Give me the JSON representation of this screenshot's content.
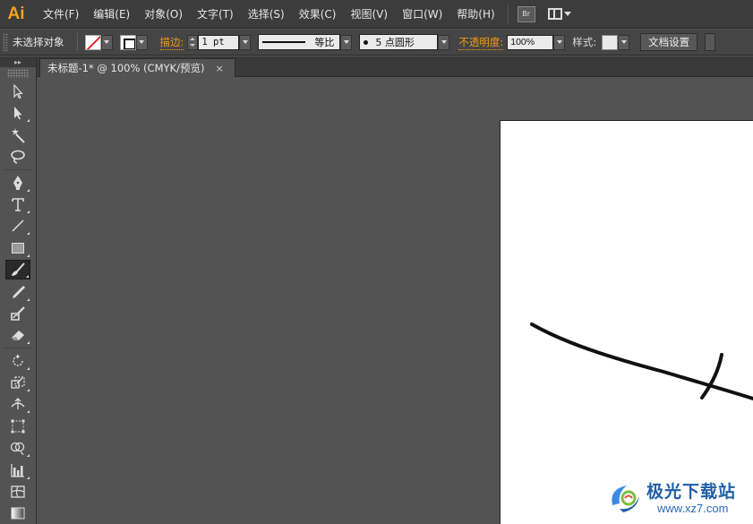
{
  "app": {
    "logo": "Ai",
    "accent": "#f7a21b"
  },
  "menu": {
    "items": [
      "文件(F)",
      "编辑(E)",
      "对象(O)",
      "文字(T)",
      "选择(S)",
      "效果(C)",
      "视图(V)",
      "窗口(W)",
      "帮助(H)"
    ],
    "bridge_label": "Br",
    "workspace_icon": "workspace-layout-icon"
  },
  "control": {
    "selection_label": "未选择对象",
    "stroke_label": "描边:",
    "stroke_weight": "1 pt",
    "profile_label": "等比",
    "brush_label": "5 点圆形",
    "opacity_label": "不透明度:",
    "opacity_value": "100%",
    "style_label": "样式:",
    "doc_setup_label": "文档设置"
  },
  "tabs": {
    "doc_title": "未标题-1* @ 100% (CMYK/预览)",
    "close": "×"
  },
  "tools": [
    "selection-tool-icon",
    "direct-selection-tool-icon",
    "magic-wand-tool-icon",
    "lasso-tool-icon",
    "pen-tool-icon",
    "type-tool-icon",
    "line-segment-tool-icon",
    "rectangle-tool-icon",
    "paintbrush-tool-icon",
    "pencil-tool-icon",
    "blob-brush-tool-icon",
    "eraser-tool-icon",
    "rotate-tool-icon",
    "scale-tool-icon",
    "width-tool-icon",
    "free-transform-tool-icon",
    "shape-builder-tool-icon",
    "graph-tool-icon",
    "mesh-tool-icon",
    "gradient-tool-icon"
  ],
  "active_tool": "paintbrush-tool-icon",
  "watermark": {
    "title": "极光下载站",
    "url": "www.xz7.com"
  }
}
